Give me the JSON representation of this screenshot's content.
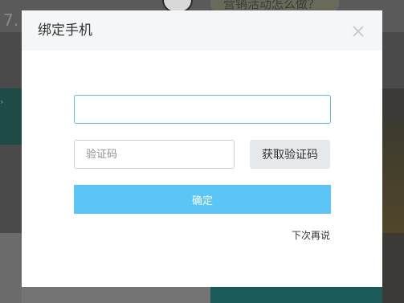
{
  "background": {
    "left_number": "7.",
    "banner_text": "营销活动怎么做？"
  },
  "modal": {
    "title": "绑定手机",
    "close_icon": "close-icon",
    "phone_input": {
      "value": "",
      "placeholder": ""
    },
    "code_input": {
      "value": "",
      "placeholder": "验证码"
    },
    "get_code_label": "获取验证码",
    "confirm_label": "确定",
    "later_label": "下次再说"
  },
  "colors": {
    "accent": "#5bc6f5",
    "focus_border": "#5bc0de",
    "header_bg": "#f5f6f7",
    "secondary_button_bg": "#e6e9ec"
  }
}
